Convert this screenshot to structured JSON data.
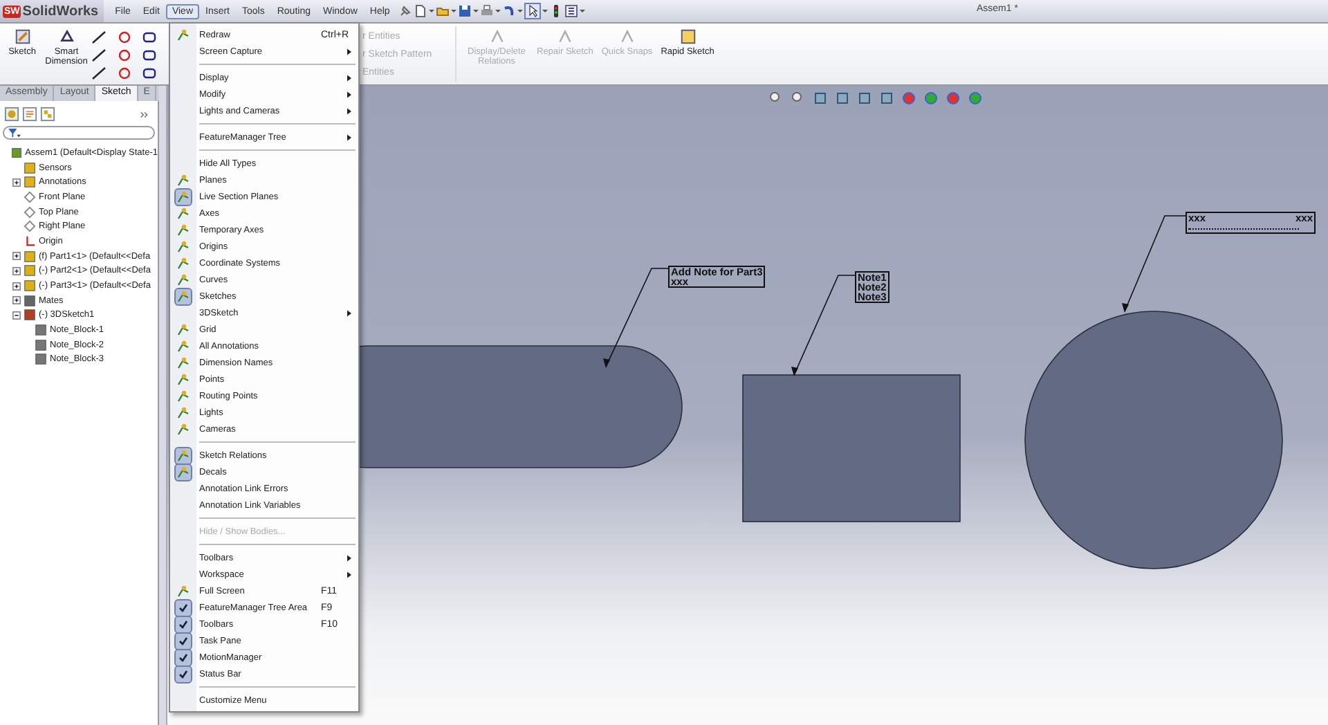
{
  "app": {
    "logo_badge": "SW",
    "logo": "SolidWorks",
    "title": "Assem1 *"
  },
  "menu_bar": [
    {
      "label": "File",
      "selected": false
    },
    {
      "label": "Edit",
      "selected": false
    },
    {
      "label": "View",
      "selected": true
    },
    {
      "label": "Insert",
      "selected": false
    },
    {
      "label": "Tools",
      "selected": false
    },
    {
      "label": "Routing",
      "selected": false
    },
    {
      "label": "Window",
      "selected": false
    },
    {
      "label": "Help",
      "selected": false
    }
  ],
  "ribbon": {
    "commands": [
      {
        "label": "Sketch",
        "disabled": false
      },
      {
        "label": "Smart Dimension",
        "disabled": false
      }
    ],
    "partial_commands": [
      {
        "label": "r Entities",
        "disabled": true
      },
      {
        "label": "r Sketch Pattern",
        "disabled": true
      },
      {
        "label": "Entities",
        "disabled": true
      }
    ],
    "right_commands": [
      {
        "label": "Display/Delete Relations",
        "disabled": true
      },
      {
        "label": "Repair Sketch",
        "disabled": true
      },
      {
        "label": "Quick Snaps",
        "disabled": true
      },
      {
        "label": "Rapid Sketch",
        "disabled": false
      }
    ]
  },
  "tabs": [
    {
      "label": "Assembly",
      "selected": false
    },
    {
      "label": "Layout",
      "selected": false
    },
    {
      "label": "Sketch",
      "selected": true
    },
    {
      "label": "E",
      "selected": false
    }
  ],
  "tree": [
    {
      "label": "Assem1  (Default<Display State-1",
      "kind": "assembly",
      "has_toggle": false,
      "children": [
        {
          "label": "Sensors",
          "kind": "sensors",
          "has_toggle": false
        },
        {
          "label": "Annotations",
          "kind": "annotations",
          "has_toggle": true,
          "expanded": false
        },
        {
          "label": "Front Plane",
          "kind": "plane",
          "has_toggle": false
        },
        {
          "label": "Top Plane",
          "kind": "plane",
          "has_toggle": false
        },
        {
          "label": "Right Plane",
          "kind": "plane",
          "has_toggle": false
        },
        {
          "label": "Origin",
          "kind": "origin",
          "has_toggle": false
        },
        {
          "label": "(f) Part1<1> (Default<<Defa",
          "kind": "part",
          "has_toggle": true,
          "expanded": false
        },
        {
          "label": "(-) Part2<1> (Default<<Defa",
          "kind": "part",
          "has_toggle": true,
          "expanded": false
        },
        {
          "label": "(-) Part3<1> (Default<<Defa",
          "kind": "part",
          "has_toggle": true,
          "expanded": false
        },
        {
          "label": "Mates",
          "kind": "mates",
          "has_toggle": true,
          "expanded": false
        },
        {
          "label": "(-) 3DSketch1",
          "kind": "sketch",
          "has_toggle": true,
          "expanded": true,
          "children": [
            {
              "label": "Note_Block-1",
              "kind": "note",
              "has_toggle": false
            },
            {
              "label": "Note_Block-2",
              "kind": "note",
              "has_toggle": false
            },
            {
              "label": "Note_Block-3",
              "kind": "note",
              "has_toggle": false
            }
          ]
        }
      ]
    }
  ],
  "view_menu": [
    {
      "kind": "item",
      "label": "Redraw",
      "shortcut": "Ctrl+R",
      "submenu": false,
      "icon": true,
      "checked": false,
      "disabled": false
    },
    {
      "kind": "item",
      "label": "Screen Capture",
      "submenu": true,
      "icon": false,
      "checked": false,
      "disabled": false
    },
    {
      "kind": "separator"
    },
    {
      "kind": "item",
      "label": "Display",
      "submenu": true,
      "icon": false,
      "checked": false,
      "disabled": false
    },
    {
      "kind": "item",
      "label": "Modify",
      "submenu": true,
      "icon": false,
      "checked": false,
      "disabled": false
    },
    {
      "kind": "item",
      "label": "Lights and Cameras",
      "submenu": true,
      "icon": false,
      "checked": false,
      "disabled": false
    },
    {
      "kind": "separator"
    },
    {
      "kind": "item",
      "label": "FeatureManager Tree",
      "submenu": true,
      "icon": false,
      "checked": false,
      "disabled": false
    },
    {
      "kind": "separator"
    },
    {
      "kind": "item",
      "label": "Hide All Types",
      "submenu": false,
      "icon": false,
      "checked": false,
      "disabled": false
    },
    {
      "kind": "item",
      "label": "Planes",
      "submenu": false,
      "icon": true,
      "checked": false,
      "disabled": false
    },
    {
      "kind": "item",
      "label": "Live Section Planes",
      "submenu": false,
      "icon": true,
      "checked": true,
      "disabled": false
    },
    {
      "kind": "item",
      "label": "Axes",
      "submenu": false,
      "icon": true,
      "checked": false,
      "disabled": false
    },
    {
      "kind": "item",
      "label": "Temporary Axes",
      "submenu": false,
      "icon": true,
      "checked": false,
      "disabled": false
    },
    {
      "kind": "item",
      "label": "Origins",
      "submenu": false,
      "icon": true,
      "checked": false,
      "disabled": false
    },
    {
      "kind": "item",
      "label": "Coordinate Systems",
      "submenu": false,
      "icon": true,
      "checked": false,
      "disabled": false
    },
    {
      "kind": "item",
      "label": "Curves",
      "submenu": false,
      "icon": true,
      "checked": false,
      "disabled": false
    },
    {
      "kind": "item",
      "label": "Sketches",
      "submenu": false,
      "icon": true,
      "checked": true,
      "disabled": false
    },
    {
      "kind": "item",
      "label": "3DSketch",
      "submenu": true,
      "icon": false,
      "checked": false,
      "disabled": false
    },
    {
      "kind": "item",
      "label": "Grid",
      "submenu": false,
      "icon": true,
      "checked": false,
      "disabled": false
    },
    {
      "kind": "item",
      "label": "All Annotations",
      "submenu": false,
      "icon": true,
      "checked": false,
      "disabled": false
    },
    {
      "kind": "item",
      "label": "Dimension Names",
      "submenu": false,
      "icon": true,
      "checked": false,
      "disabled": false
    },
    {
      "kind": "item",
      "label": "Points",
      "submenu": false,
      "icon": true,
      "checked": false,
      "disabled": false
    },
    {
      "kind": "item",
      "label": "Routing Points",
      "submenu": false,
      "icon": true,
      "checked": false,
      "disabled": false
    },
    {
      "kind": "item",
      "label": "Lights",
      "submenu": false,
      "icon": true,
      "checked": false,
      "disabled": false
    },
    {
      "kind": "item",
      "label": "Cameras",
      "submenu": false,
      "icon": true,
      "checked": false,
      "disabled": false
    },
    {
      "kind": "separator"
    },
    {
      "kind": "item",
      "label": "Sketch Relations",
      "submenu": false,
      "icon": true,
      "checked": true,
      "disabled": false
    },
    {
      "kind": "item",
      "label": "Decals",
      "submenu": false,
      "icon": true,
      "checked": true,
      "disabled": false
    },
    {
      "kind": "item",
      "label": "Annotation Link Errors",
      "submenu": false,
      "icon": false,
      "checked": false,
      "disabled": false
    },
    {
      "kind": "item",
      "label": "Annotation Link Variables",
      "submenu": false,
      "icon": false,
      "checked": false,
      "disabled": false
    },
    {
      "kind": "separator"
    },
    {
      "kind": "item",
      "label": "Hide / Show Bodies...",
      "submenu": false,
      "icon": false,
      "checked": false,
      "disabled": true
    },
    {
      "kind": "separator"
    },
    {
      "kind": "item",
      "label": "Toolbars",
      "submenu": true,
      "icon": false,
      "checked": false,
      "disabled": false
    },
    {
      "kind": "item",
      "label": "Workspace",
      "submenu": true,
      "icon": false,
      "checked": false,
      "disabled": false
    },
    {
      "kind": "item",
      "label": "Full Screen",
      "shortcut": "F11",
      "submenu": false,
      "icon": true,
      "checked": false,
      "disabled": false
    },
    {
      "kind": "toggle",
      "label": "FeatureManager Tree Area",
      "shortcut": "F9",
      "submenu": false,
      "checked": true,
      "disabled": false
    },
    {
      "kind": "toggle",
      "label": "Toolbars",
      "shortcut": "F10",
      "submenu": false,
      "checked": true,
      "disabled": false
    },
    {
      "kind": "toggle",
      "label": "Task Pane",
      "submenu": false,
      "checked": true,
      "disabled": false
    },
    {
      "kind": "toggle",
      "label": "MotionManager",
      "submenu": false,
      "checked": true,
      "disabled": false
    },
    {
      "kind": "toggle",
      "label": "Status Bar",
      "submenu": false,
      "checked": true,
      "disabled": false
    },
    {
      "kind": "separator"
    },
    {
      "kind": "item",
      "label": "Customize Menu",
      "submenu": false,
      "icon": false,
      "checked": false,
      "disabled": false
    }
  ],
  "canvas": {
    "shapes": [
      {
        "kind": "slot"
      },
      {
        "kind": "rectangle"
      },
      {
        "kind": "circle"
      }
    ],
    "notes": [
      {
        "kind": "stack",
        "lines": [
          "Add Note for Part3",
          "xxx"
        ]
      },
      {
        "kind": "stack",
        "lines": [
          "Note1",
          "Note2",
          "Note3"
        ]
      },
      {
        "kind": "row",
        "lines": [
          "xxx",
          "xxx"
        ]
      }
    ]
  }
}
